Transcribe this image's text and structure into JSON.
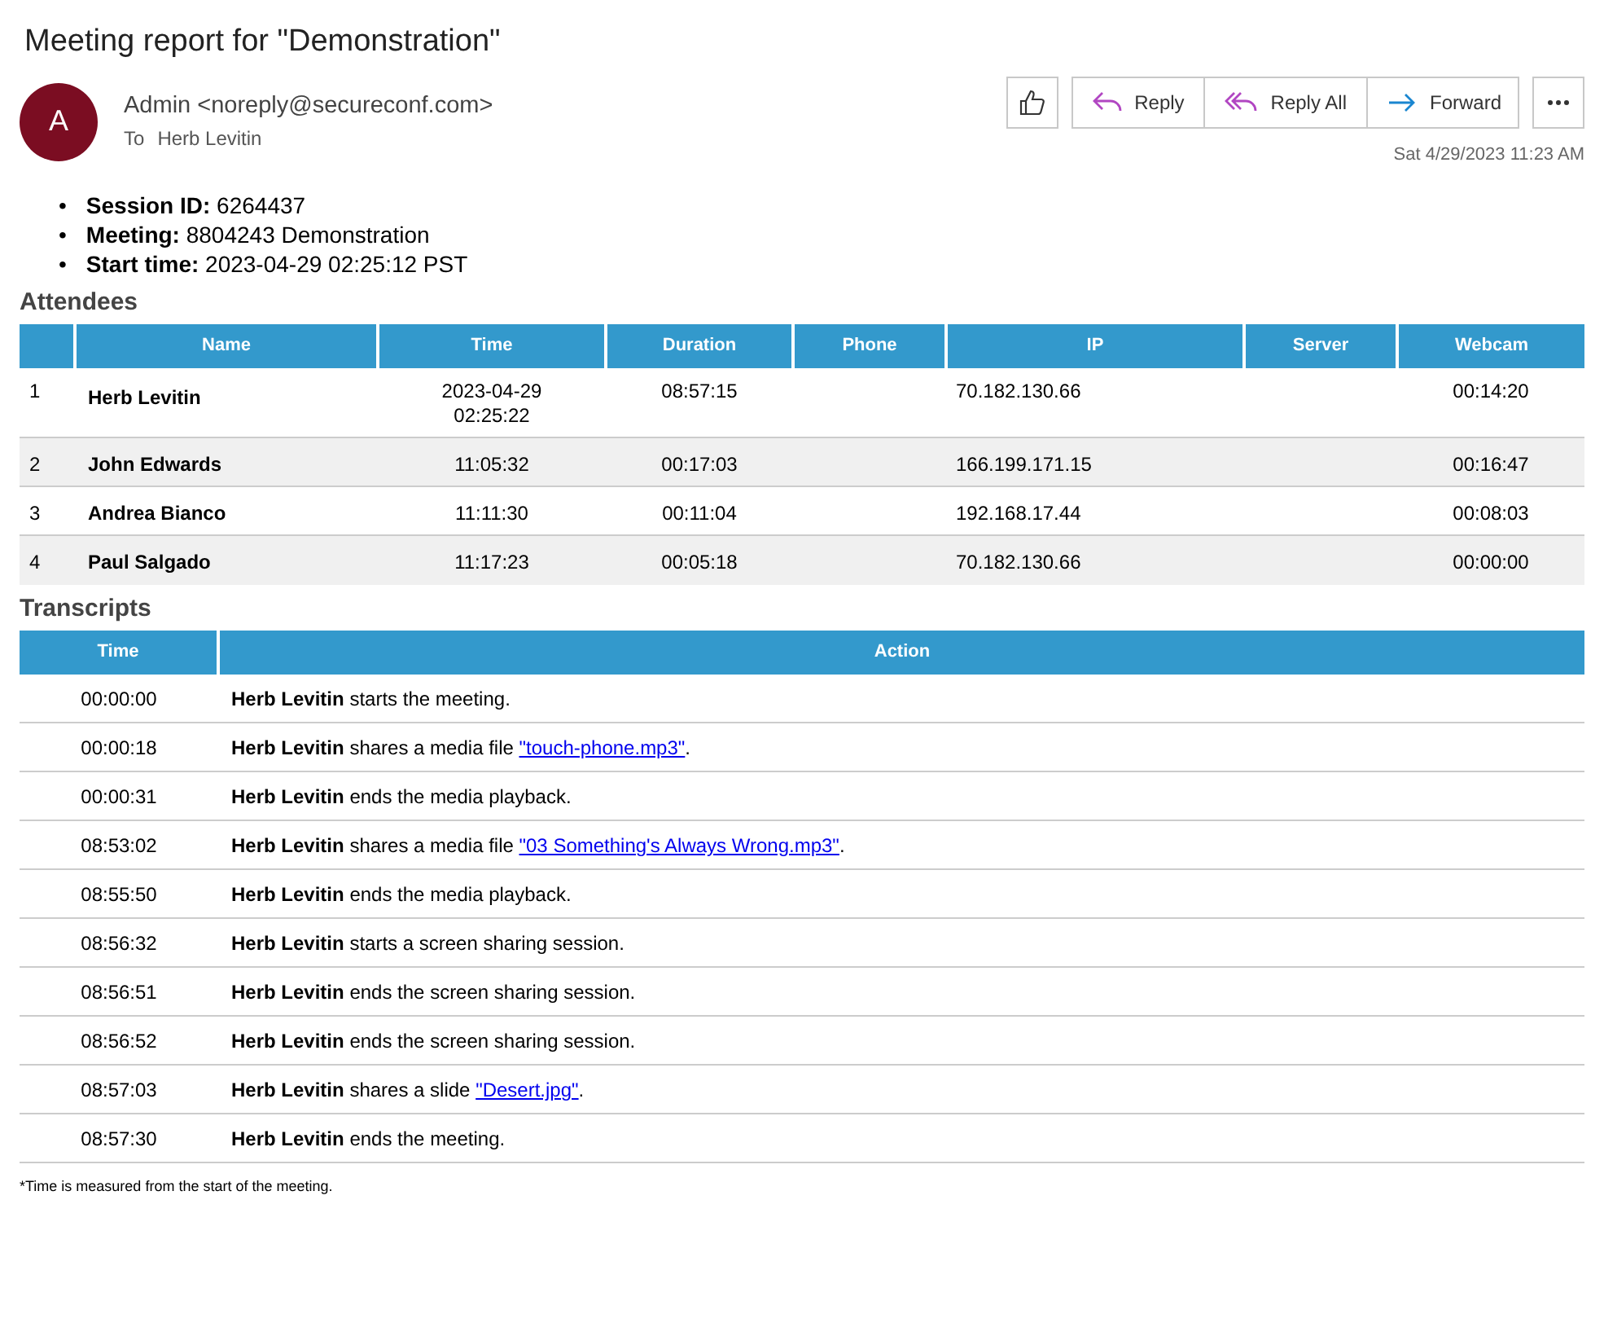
{
  "subject": "Meeting report for \"Demonstration\"",
  "sender": {
    "avatar_letter": "A",
    "name": "Admin <noreply@secureconf.com>",
    "to_label": "To",
    "to": "Herb Levitin",
    "date": "Sat 4/29/2023 11:23 AM"
  },
  "actions": [
    "Reply",
    "Reply All",
    "Forward"
  ],
  "session_info": [
    {
      "bullet": "•",
      "text": "**Session ID:** 6264437"
    },
    {
      "bullet": "•",
      "text": "**Meeting:** 8804243 Demonstration"
    },
    {
      "bullet": "•",
      "text": "**Start time:** 2023-04-29 02:25:12 PST"
    }
  ],
  "attendees": {
    "title": "Attendees",
    "columns": [
      "Name",
      "Time",
      "Duration",
      "Phone",
      "IP",
      "Server",
      "Webcam"
    ],
    "rows": [
      {
        "index": "1",
        "name": "Herb Levitin",
        "time": "2023-04-29 02:25:22",
        "duration": "08:57:15",
        "ip": "70.182.130.66",
        "webcam": "00:14:20"
      },
      {
        "index": "2",
        "name": "John Edwards",
        "time": "11:05:32",
        "duration": "00:17:03",
        "ip": "166.199.171.15",
        "webcam": "00:16:47"
      },
      {
        "index": "3",
        "name": "Andrea Bianco",
        "time": "11:11:30",
        "duration": "00:11:04",
        "ip": "192.168.17.44",
        "webcam": "00:08:03"
      },
      {
        "index": "4",
        "name": "Paul Salgado",
        "time": "11:17:23",
        "duration": "00:05:18",
        "ip": "70.182.130.66",
        "webcam": "00:00:00"
      }
    ]
  },
  "transcripts": {
    "title": "Transcripts",
    "columns": [
      "Time",
      "Action"
    ],
    "rows": [
      {
        "time": "00:00:00",
        "action": [
          {
            "kind": "actor",
            "text": "Herb Levitin"
          },
          {
            "kind": "text",
            "text": " starts the meeting."
          }
        ]
      },
      {
        "time": "00:00:18",
        "action": [
          {
            "kind": "actor",
            "text": "Herb Levitin"
          },
          {
            "kind": "text",
            "text": " shares a media file "
          },
          {
            "kind": "link",
            "text": "\"touch-phone.mp3\""
          },
          {
            "kind": "text",
            "text": "."
          }
        ]
      },
      {
        "time": "00:00:31",
        "action": [
          {
            "kind": "actor",
            "text": "Herb Levitin"
          },
          {
            "kind": "text",
            "text": " ends the media playback."
          }
        ]
      },
      {
        "time": "08:53:02",
        "action": [
          {
            "kind": "actor",
            "text": "Herb Levitin"
          },
          {
            "kind": "text",
            "text": " shares a media file "
          },
          {
            "kind": "link",
            "text": "\"03 Something's Always Wrong.mp3\""
          },
          {
            "kind": "text",
            "text": "."
          }
        ]
      },
      {
        "time": "08:55:50",
        "action": [
          {
            "kind": "actor",
            "text": "Herb Levitin"
          },
          {
            "kind": "text",
            "text": " ends the media playback."
          }
        ]
      },
      {
        "time": "08:56:32",
        "action": [
          {
            "kind": "actor",
            "text": "Herb Levitin"
          },
          {
            "kind": "text",
            "text": " starts a screen sharing session."
          }
        ]
      },
      {
        "time": "08:56:51",
        "action": [
          {
            "kind": "actor",
            "text": "Herb Levitin"
          },
          {
            "kind": "text",
            "text": " ends the screen sharing session."
          }
        ]
      },
      {
        "time": "08:56:52",
        "action": [
          {
            "kind": "actor",
            "text": "Herb Levitin"
          },
          {
            "kind": "text",
            "text": " ends the screen sharing session."
          }
        ]
      },
      {
        "time": "08:57:03",
        "action": [
          {
            "kind": "actor",
            "text": "Herb Levitin"
          },
          {
            "kind": "text",
            "text": " shares a slide "
          },
          {
            "kind": "link",
            "text": "\"Desert.jpg\""
          },
          {
            "kind": "text",
            "text": "."
          }
        ]
      },
      {
        "time": "08:57:30",
        "action": [
          {
            "kind": "actor",
            "text": "Herb Levitin"
          },
          {
            "kind": "text",
            "text": " ends the meeting."
          }
        ]
      }
    ]
  },
  "footnote": "*Time is measured from the start of the meeting."
}
